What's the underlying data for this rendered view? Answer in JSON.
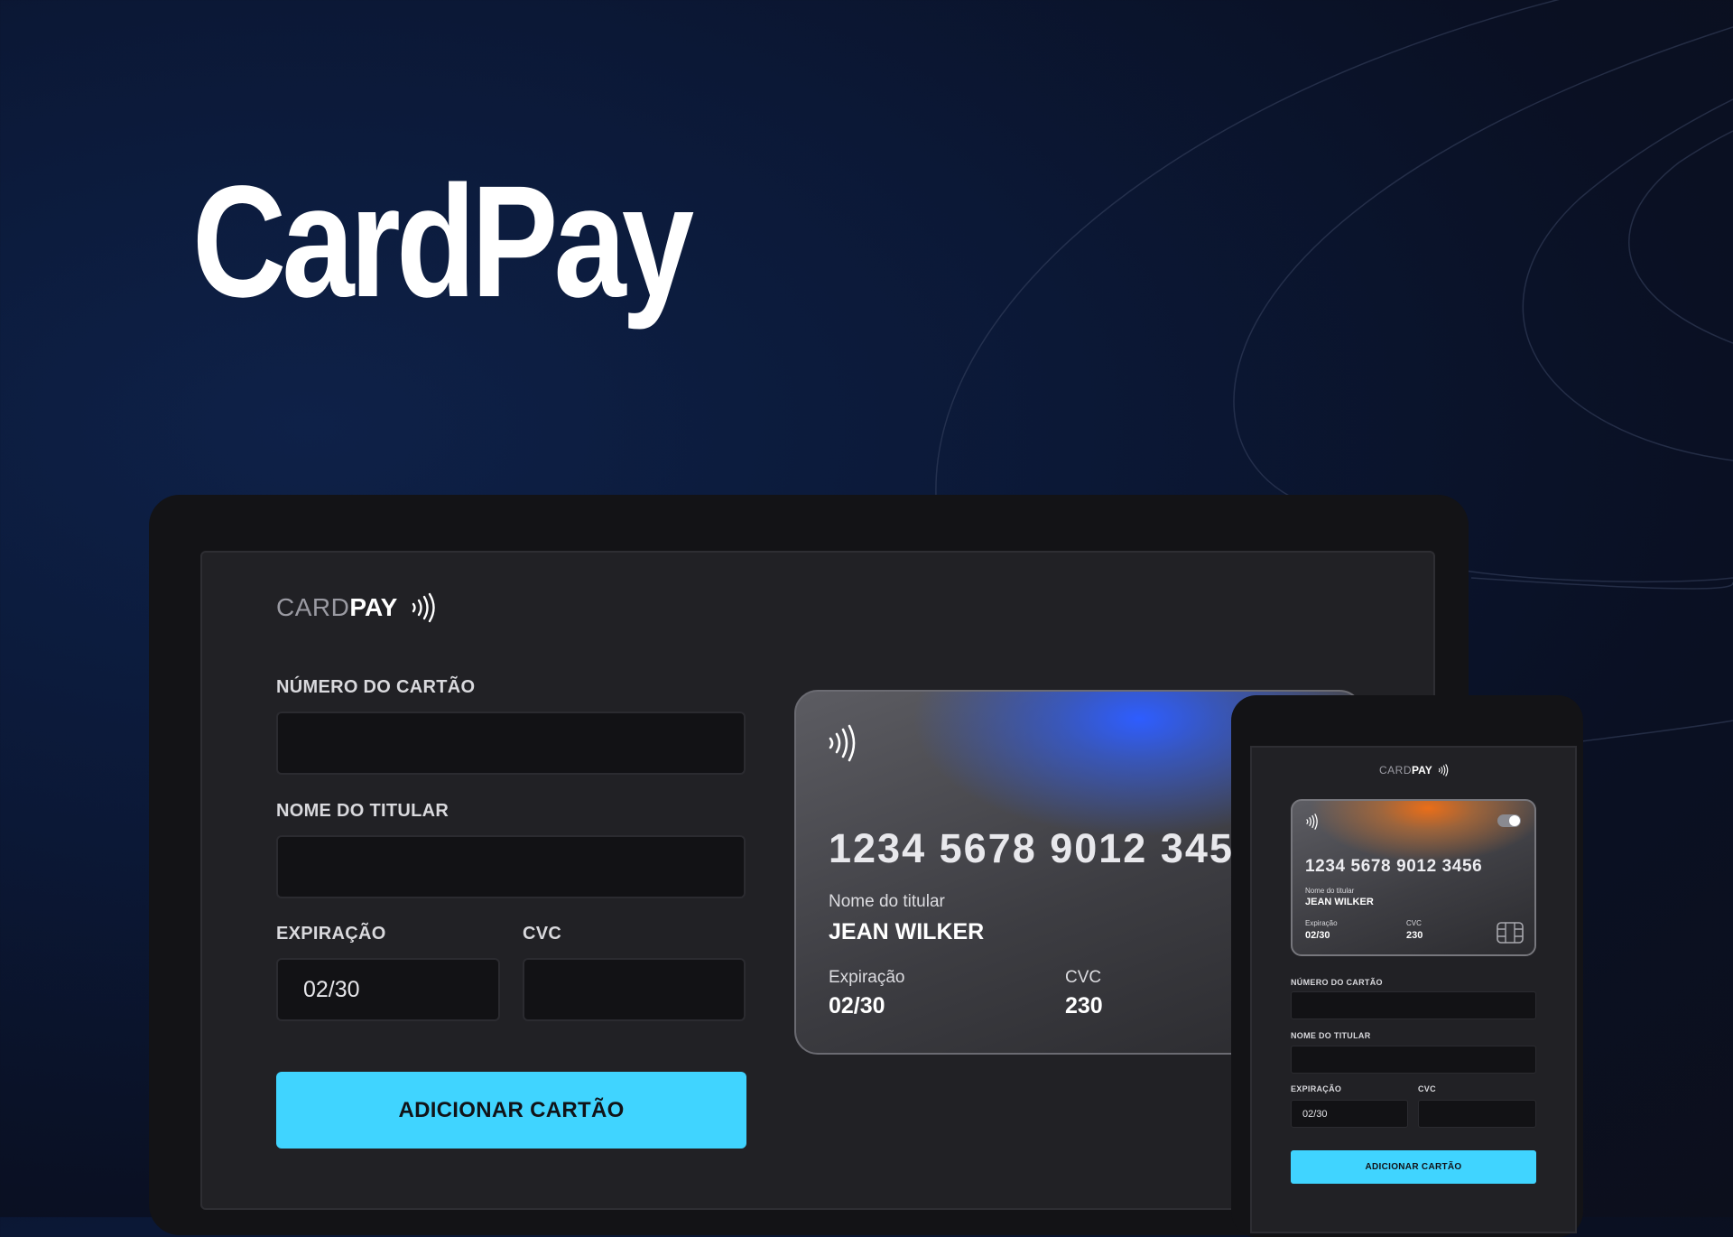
{
  "hero": {
    "title": "CardPay"
  },
  "brand": {
    "card": "CARD",
    "pay": "PAY"
  },
  "desktop": {
    "labels": {
      "card_number": "NÚMERO DO CARTÃO",
      "holder_name": "NOME DO TITULAR",
      "expiration": "EXPIRAÇÃO",
      "cvc": "CVC"
    },
    "values": {
      "card_number": "",
      "holder_name": "",
      "expiration": "02/30",
      "cvc": ""
    },
    "button": "ADICIONAR CARTÃO",
    "card_preview": {
      "number": "1234 5678 9012 345",
      "holder_label": "Nome do titular",
      "holder": "JEAN WILKER",
      "exp_label": "Expiração",
      "exp": "02/30",
      "cvc_label": "CVC",
      "cvc": "230"
    }
  },
  "mobile": {
    "card_preview": {
      "number": "1234 5678 9012 3456",
      "holder_label": "Nome do titular",
      "holder": "JEAN WILKER",
      "exp_label": "Expiração",
      "exp": "02/30",
      "cvc_label": "CVC",
      "cvc": "230"
    },
    "labels": {
      "card_number": "NÚMERO DO CARTÃO",
      "holder_name": "NOME DO TITULAR",
      "expiration": "EXPIRAÇÃO",
      "cvc": "CVC"
    },
    "values": {
      "expiration": "02/30"
    },
    "button": "ADICIONAR CARTÃO"
  },
  "colors": {
    "accent": "#40d4ff",
    "background": "#0b1836",
    "panel": "#212125",
    "input": "#121215",
    "card_glow_desktop": "#2e5dff",
    "card_glow_mobile": "#ea6e19"
  },
  "icons": [
    "contactless-icon",
    "chip-icon",
    "toggle-icon"
  ]
}
